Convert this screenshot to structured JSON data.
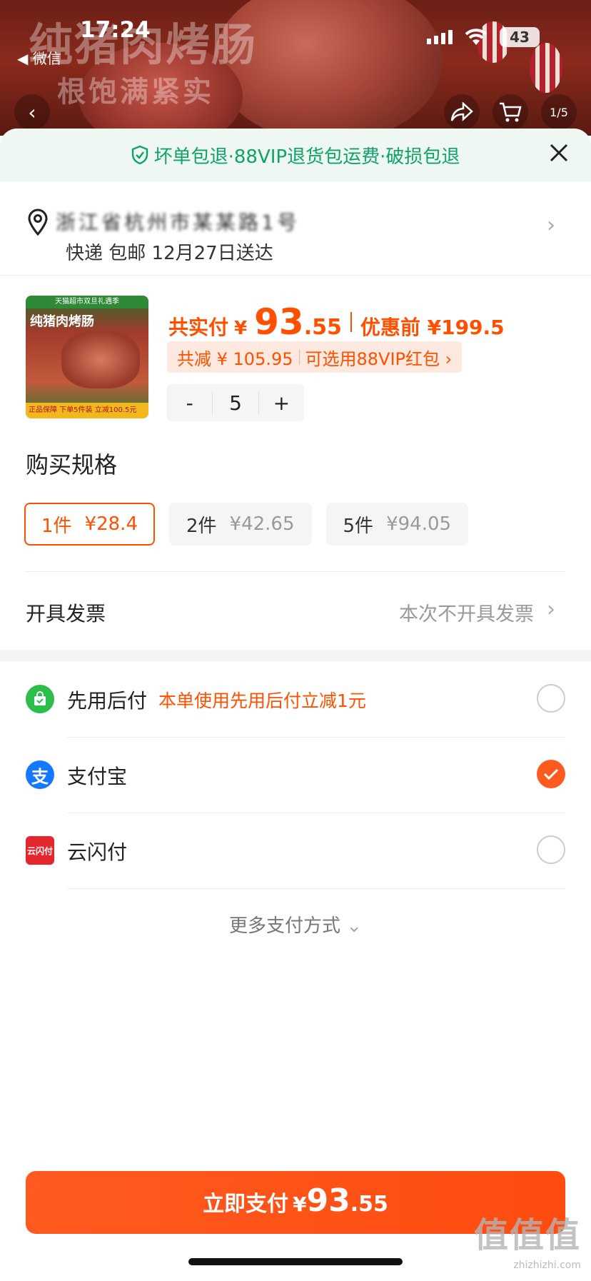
{
  "status_bar": {
    "time": "17:24",
    "back_app": "◀ 微信",
    "battery": "43"
  },
  "hero": {
    "title": "纯猪肉烤肠",
    "subtitle": "根饱满紧实",
    "badge": "1/5"
  },
  "guarantee": {
    "text": "坏单包退·88VIP退货包运费·破损包退"
  },
  "address": {
    "line": "浙江省杭州市某某路1号",
    "delivery": "快递 包邮 12月27日送达"
  },
  "product": {
    "image_top": "天猫超市双旦礼遇季",
    "image_title": "纯猪肉烤肠",
    "image_bottom": "正品保障  下单5件装 立减100.5元",
    "total_label": "共实付",
    "currency": "¥",
    "price_int": "93",
    "price_dec": ".55",
    "orig_price": "优惠前 ¥199.5",
    "discount_text": "共减 ¥ 105.95",
    "vip_text": "可选用88VIP红包 ›",
    "qty_minus": "-",
    "qty": "5",
    "qty_plus": "+"
  },
  "spec": {
    "title": "购买规格",
    "options": [
      {
        "label": "1件",
        "price": "¥28.4"
      },
      {
        "label": "2件",
        "price": "¥42.65"
      },
      {
        "label": "5件",
        "price": "¥94.05"
      }
    ]
  },
  "invoice": {
    "label": "开具发票",
    "value": "本次不开具发票"
  },
  "payment": {
    "methods": [
      {
        "label": "先用后付",
        "promo": "本单使用先用后付立减1元",
        "icon": "bag-icon",
        "color": "#2bbf4a"
      },
      {
        "label": "支付宝",
        "promo": "",
        "icon": "alipay-icon",
        "color": "#1677ff"
      },
      {
        "label": "云闪付",
        "promo": "",
        "icon": "unionpay-icon",
        "color": "#e5262d"
      }
    ],
    "more": "更多支付方式"
  },
  "pay_button": {
    "label": "立即支付",
    "currency": "¥",
    "amount_int": "93",
    "amount_dec": ".55"
  },
  "watermark": {
    "main": "值值值",
    "sub": "zhizhizhi.com"
  },
  "colors": {
    "accent": "#ff5000",
    "guarantee_green": "#0fa36a"
  }
}
